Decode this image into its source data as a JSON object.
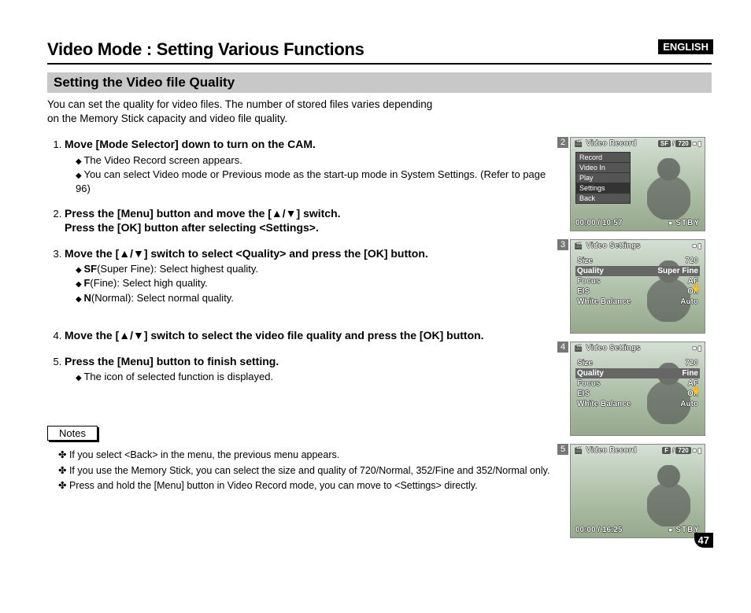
{
  "header": {
    "language_tag": "ENGLISH",
    "title": "Video Mode : Setting Various Functions"
  },
  "section": {
    "subtitle": "Setting the Video file Quality",
    "intro_l1": "You can set the quality for video files. The number of stored files varies depending",
    "intro_l2": "on the Memory Stick capacity and video file quality."
  },
  "steps": [
    {
      "head": "Move [Mode Selector] down to turn on the CAM.",
      "sub": [
        "The Video Record screen appears.",
        "You can select Video mode or Previous mode as the start-up mode in System Settings. (Refer to page 96)"
      ]
    },
    {
      "head_a": "Press the [Menu] button and move the [",
      "head_sym": "▲/▼",
      "head_b": "] switch.",
      "head_l2": "Press the [OK] button after selecting <Settings>.",
      "sub": []
    },
    {
      "head_a": "Move the [",
      "head_sym": "▲/▼",
      "head_b": "] switch to select <Quality> and press the [OK] button.",
      "sub": [
        "SF(Super Fine): Select highest quality.",
        "F(Fine): Select high quality.",
        "N(Normal): Select normal quality."
      ],
      "bold_prefixes": [
        "SF",
        "F",
        "N"
      ]
    },
    {
      "head_a": "Move the [",
      "head_sym": "▲/▼",
      "head_b": "] switch to select the video file quality and press the [OK] button.",
      "sub": []
    },
    {
      "head": "Press the [Menu] button to finish setting.",
      "sub": [
        "The icon of selected function is displayed."
      ]
    }
  ],
  "notes": {
    "heading": "Notes",
    "items": [
      "If you select <Back> in the menu, the previous menu appears.",
      "If you use the Memory Stick, you can select the size and quality of 720/Normal, 352/Fine and 352/Normal only.",
      "Press and hold the [Menu] button in Video Record mode, you can move to <Settings> directly."
    ]
  },
  "page_number": "47",
  "thumbs": {
    "t2": {
      "num": "2",
      "title": "Video Record",
      "pill1": "SF",
      "pill2": "720",
      "menu": [
        "Record",
        "Video In",
        "Play",
        "Settings",
        "Back"
      ],
      "menu_sel_idx": 3,
      "foot_time": "00:00 / 10:57",
      "foot_state": "STBY"
    },
    "t3": {
      "num": "3",
      "title": "Video Settings",
      "rows": [
        {
          "k": "Size",
          "v": "720"
        },
        {
          "k": "Quality",
          "v": "Super Fine",
          "hl": true
        },
        {
          "k": "Focus",
          "v": "AF"
        },
        {
          "k": "EIS",
          "v": "On"
        },
        {
          "k": "White Balance",
          "v": "Auto"
        }
      ]
    },
    "t4": {
      "num": "4",
      "title": "Video Settings",
      "rows": [
        {
          "k": "Size",
          "v": "720"
        },
        {
          "k": "Quality",
          "v": "Fine",
          "hl": true
        },
        {
          "k": "Focus",
          "v": "AF"
        },
        {
          "k": "EIS",
          "v": "On"
        },
        {
          "k": "White Balance",
          "v": "Auto"
        }
      ]
    },
    "t5": {
      "num": "5",
      "title": "Video Record",
      "pill1": "F",
      "pill2": "720",
      "foot_time": "00:00 / 16:25",
      "foot_state": "STBY"
    }
  }
}
